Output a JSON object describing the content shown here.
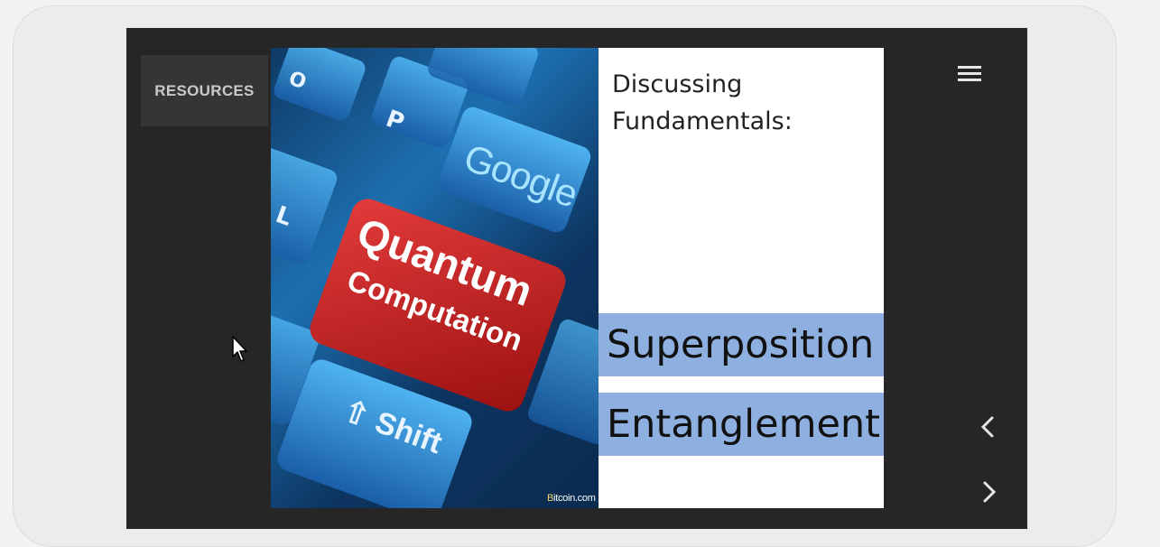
{
  "viewer": {
    "resources_label": "RESOURCES",
    "menu_icon": "hamburger-menu-icon",
    "prev_icon": "chevron-left-icon",
    "next_icon": "chevron-right-icon"
  },
  "slide": {
    "title": "Discussing Fundamentals:",
    "bullets": [
      "Superposition",
      "Entanglement"
    ],
    "band_color": "#8eb0e0",
    "image": {
      "key_main_line1": "Quantum",
      "key_main_line2": "Computation",
      "key_google": "Google",
      "key_shift": "Shift",
      "key_o": "O",
      "key_p": "P",
      "key_l": "L",
      "credit_b": "B",
      "credit_rest": "itcoin.com"
    }
  }
}
